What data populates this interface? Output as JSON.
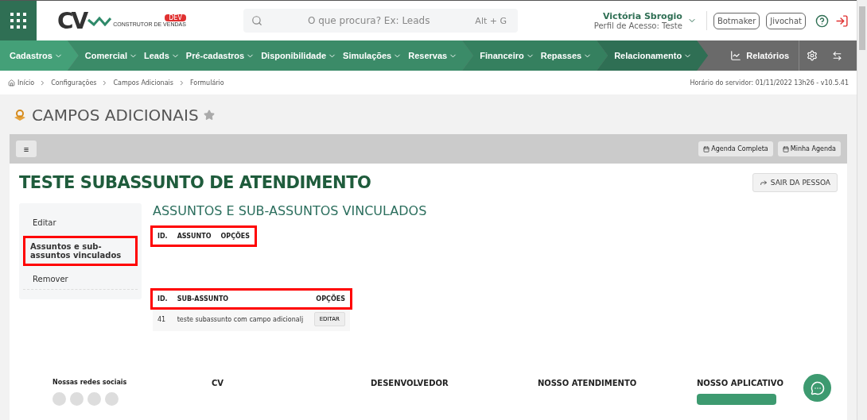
{
  "header": {
    "logo": {
      "letters": "CV",
      "badge": "DEV",
      "tagline": "CONSTRUTOR DE VENDAS"
    },
    "search": {
      "placeholder": "O que procura? Ex: Leads",
      "shortcut": "Alt + G"
    },
    "user": {
      "name": "Victória Sbrogio",
      "profile": "Perfil de Acesso: Teste"
    },
    "buttons": [
      "Botmaker",
      "Jivochat"
    ]
  },
  "nav": {
    "groups": [
      {
        "color": "#44a078",
        "items": [
          {
            "label": "Cadastros",
            "dropdown": true
          }
        ]
      },
      {
        "color": "#3b8b68",
        "items": [
          {
            "label": "Comercial",
            "dropdown": true
          },
          {
            "label": "Leads",
            "dropdown": true
          },
          {
            "label": "Pré-cadastros",
            "dropdown": true
          },
          {
            "label": "Disponibilidade",
            "dropdown": true
          },
          {
            "label": "Simulações",
            "dropdown": true
          },
          {
            "label": "Reservas",
            "dropdown": true
          }
        ]
      },
      {
        "color": "#35805f",
        "items": [
          {
            "label": "Financeiro",
            "dropdown": true
          },
          {
            "label": "Repasses",
            "dropdown": true
          }
        ]
      },
      {
        "color": "#2f6f54",
        "items": [
          {
            "label": "Relacionamento",
            "dropdown": true
          }
        ]
      }
    ],
    "reports": "Relatórios"
  },
  "breadcrumb": [
    "Início",
    "Configurações",
    "Campos Adicionais",
    "Formulário"
  ],
  "server_time": "Horário do servidor: 01/11/2022 13h26 - v10.5.41",
  "page_title": "CAMPOS ADICIONAIS",
  "toolbar": {
    "menu_glyph": "≡",
    "buttons": [
      "Agenda Completa",
      "Minha Agenda"
    ]
  },
  "record": {
    "title": "TESTE SUBASSUNTO DE ATENDIMENTO",
    "exit_button": "SAIR DA PESSOA"
  },
  "sidebar": {
    "items": [
      {
        "label": "Editar",
        "selected": false,
        "highlighted": false
      },
      {
        "label": "Assuntos e sub-assuntos vinculados",
        "selected": true,
        "highlighted": true
      },
      {
        "label": "Remover",
        "selected": false,
        "highlighted": false
      }
    ]
  },
  "section_title": "ASSUNTOS E SUB-ASSUNTOS VINCULADOS",
  "subjects_table": {
    "highlighted": true,
    "columns": [
      "ID.",
      "ASSUNTO",
      "OPÇÕES"
    ]
  },
  "subsubjects_table": {
    "highlighted": true,
    "columns": [
      "ID.",
      "SUB-ASSUNTO",
      "OPÇÕES"
    ],
    "rows": [
      {
        "id": "41",
        "name": "teste subassunto com campo adicionalj",
        "action": "EDITAR"
      }
    ]
  },
  "footer": {
    "social_heading": "Nossas redes sociais",
    "columns": [
      "CV",
      "DESENVOLVEDOR",
      "NOSSO ATENDIMENTO",
      "NOSSO APLICATIVO"
    ]
  }
}
